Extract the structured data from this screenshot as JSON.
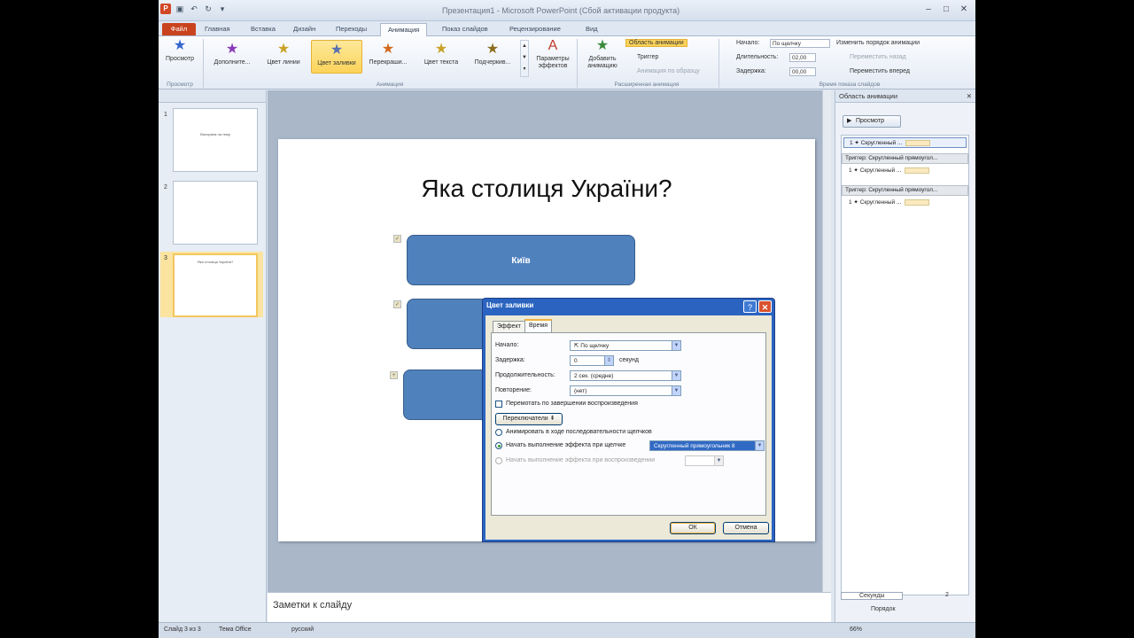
{
  "window": {
    "title": "Презентация1 - Microsoft PowerPoint (Сбой активации продукта)",
    "app_badge": "P"
  },
  "tabs": [
    "Файл",
    "Главная",
    "Вставка",
    "Дизайн",
    "Переходы",
    "Анимация",
    "Показ слайдов",
    "Рецензирование",
    "Вид"
  ],
  "ribbon": {
    "preview": "Просмотр",
    "effects": [
      "Дополните...",
      "Цвет линии",
      "Цвет заливки",
      "Перекраши...",
      "Цвет текста",
      "Подчеркив..."
    ],
    "effect_params": "Параметры эффектов",
    "add_animation": "Добавить анимацию",
    "animation_pane": "Область анимации",
    "trigger": "Триггер",
    "anim_painter": "Анимация по образцу",
    "start_label": "Начало:",
    "start_value": "По щелчку",
    "duration_label": "Длительность:",
    "duration_value": "02,00",
    "delay_label": "Задержка:",
    "delay_value": "00,00",
    "reorder": "Изменить порядок анимации",
    "move_earlier": "Переместить назад",
    "move_later": "Переместить вперед",
    "group_preview": "Просмотр",
    "group_animation": "Анимация",
    "group_advanced": "Расширенная анимация",
    "group_timing": "Время показа слайдов"
  },
  "thumbnails": [
    {
      "num": "1",
      "text": "Вікторина на тему"
    },
    {
      "num": "2",
      "text": ""
    },
    {
      "num": "3",
      "text": "Яка столиця України?"
    }
  ],
  "slide": {
    "title": "Яка столиця України?",
    "shape1": "Київ"
  },
  "notes": "Заметки к слайду",
  "pane": {
    "title": "Область анимации",
    "play": "Просмотр",
    "items": [
      {
        "num": "1",
        "label": "Скругленный ..."
      },
      {
        "num": "1",
        "label": "Скругленный ..."
      },
      {
        "num": "1",
        "label": "Скругленный ..."
      }
    ],
    "trigger1": "Триггер: Скругленный прямоугол...",
    "trigger2": "Триггер: Скругленный прямоугол...",
    "seconds": "Секунды",
    "page": "2",
    "order": "Порядок"
  },
  "status": {
    "slide": "Слайд 3 из 3",
    "theme": "Тема Office",
    "lang": "русский",
    "zoom": "66%"
  },
  "dialog": {
    "title": "Цвет заливки",
    "tab_effect": "Эффект",
    "tab_time": "Время",
    "start_label": "Начало:",
    "start_value": "По щелчку",
    "delay_label": "Задержка:",
    "delay_value": "0",
    "delay_unit": "секунд",
    "duration_label": "Продолжительность:",
    "duration_value": "2 сек. (средне)",
    "repeat_label": "Повторение:",
    "repeat_value": "(нет)",
    "rewind": "Перемотать по завершении воспроизведения",
    "triggers": "Переключатели",
    "opt1": "Анимировать в ходе последовательности щелчков",
    "opt2": "Начать выполнение эффекта при щелчке",
    "opt2_value": "Скругленный прямоугольник 8",
    "opt3": "Начать выполнение эффекта при воспроизведении",
    "ok": "ОК",
    "cancel": "Отмена"
  }
}
